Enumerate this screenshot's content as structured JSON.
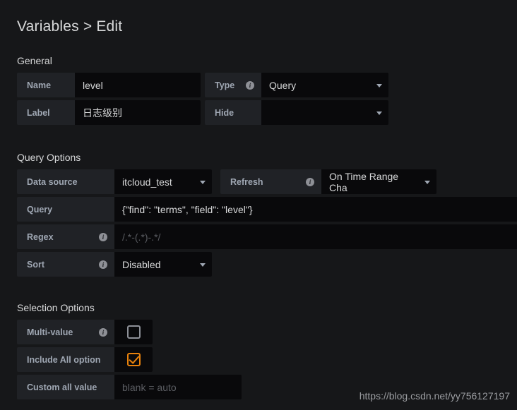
{
  "page": {
    "title": "Variables > Edit",
    "watermark": "https://blog.csdn.net/yy756127197"
  },
  "sections": {
    "general": "General",
    "query_options": "Query Options",
    "selection_options": "Selection Options"
  },
  "general": {
    "name": {
      "label": "Name",
      "value": "level"
    },
    "label": {
      "label": "Label",
      "value": "日志级别"
    },
    "type": {
      "label": "Type",
      "value": "Query",
      "info": "i",
      "caret": "chevron-down-icon"
    },
    "hide": {
      "label": "Hide",
      "value": "",
      "caret": "chevron-down-icon"
    }
  },
  "query_options": {
    "data_source": {
      "label": "Data source",
      "value": "itcloud_test",
      "caret": "chevron-down-icon"
    },
    "refresh": {
      "label": "Refresh",
      "value": "On Time Range Cha",
      "info": "i",
      "caret": "chevron-down-icon"
    },
    "query": {
      "label": "Query",
      "value": "{\"find\": \"terms\", \"field\": \"level\"}"
    },
    "regex": {
      "label": "Regex",
      "placeholder": "/.*-(.*)-.*/",
      "value": "",
      "info": "i"
    },
    "sort": {
      "label": "Sort",
      "value": "Disabled",
      "info": "i",
      "caret": "chevron-down-icon"
    }
  },
  "selection_options": {
    "multi_value": {
      "label": "Multi-value",
      "info": "i",
      "checked": false
    },
    "include_all": {
      "label": "Include All option",
      "checked": true
    },
    "custom_all_value": {
      "label": "Custom all value",
      "placeholder": "blank = auto",
      "value": ""
    }
  },
  "colors": {
    "background": "#161719",
    "label_bg": "#202226",
    "field_bg": "#09090b",
    "accent": "#e8820c",
    "text": "#d8d9da",
    "muted": "#9fa7b3"
  }
}
